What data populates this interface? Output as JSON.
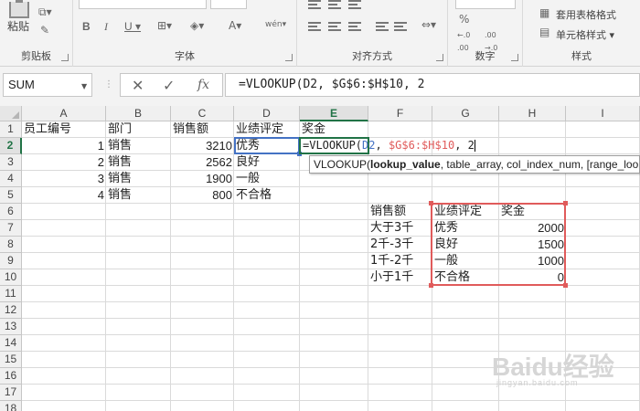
{
  "ribbon": {
    "paste": "粘贴",
    "groups": {
      "clipboard": "剪贴板",
      "font": "字体",
      "alignment": "对齐方式",
      "number": "数字",
      "styles": "样式"
    },
    "number_format": "%",
    "wen_label": "wén",
    "table_format": "套用表格格式",
    "cell_styles": "单元格样式"
  },
  "formula_bar": {
    "name_box": "SUM",
    "cancel_icon": "✕",
    "enter_icon": "✓",
    "fx_icon": "fx",
    "formula": "=VLOOKUP(D2, $G$6:$H$10, 2"
  },
  "columns": [
    "A",
    "B",
    "C",
    "D",
    "E",
    "F",
    "G",
    "H",
    "I"
  ],
  "rows": [
    "1",
    "2",
    "3",
    "4",
    "5",
    "6",
    "7",
    "8",
    "9",
    "10",
    "11",
    "12",
    "13",
    "14",
    "15",
    "16",
    "17",
    "18"
  ],
  "cells": {
    "A1": "员工编号",
    "B1": "部门",
    "C1": "销售额",
    "D1": "业绩评定",
    "E1": "奖金",
    "A2": "1",
    "B2": "销售",
    "C2": "3210",
    "D2": "优秀",
    "A3": "2",
    "B3": "销售",
    "C3": "2562",
    "D3": "良好",
    "A4": "3",
    "B4": "销售",
    "C4": "1900",
    "D4": "一般",
    "A5": "4",
    "B5": "销售",
    "C5": "800",
    "D5": "不合格",
    "F6": "销售额",
    "G6": "业绩评定",
    "H6": "奖金",
    "F7": "大于3千",
    "G7": "优秀",
    "H7": "2000",
    "F8": "2千-3千",
    "G8": "良好",
    "H8": "1500",
    "F9": "1千-2千",
    "G9": "一般",
    "H9": "1000",
    "F10": "小于1千",
    "G10": "不合格",
    "H10": "0"
  },
  "editing": {
    "prefix": "=VLOOKUP(",
    "ref1": "D2",
    "sep1": ", ",
    "ref2": "$G$6:$H$10",
    "sep2": ", 2"
  },
  "tooltip": {
    "func": "VLOOKUP(",
    "arg_bold": "lookup_value",
    "rest": ", table_array, col_index_num, [range_lookup])"
  },
  "watermark": {
    "main": "Baidu经验",
    "sub": "jingyan.baidu.com"
  },
  "colors": {
    "accent": "#217346",
    "ref_blue": "#4472c4",
    "ref_red": "#e05b5b"
  }
}
